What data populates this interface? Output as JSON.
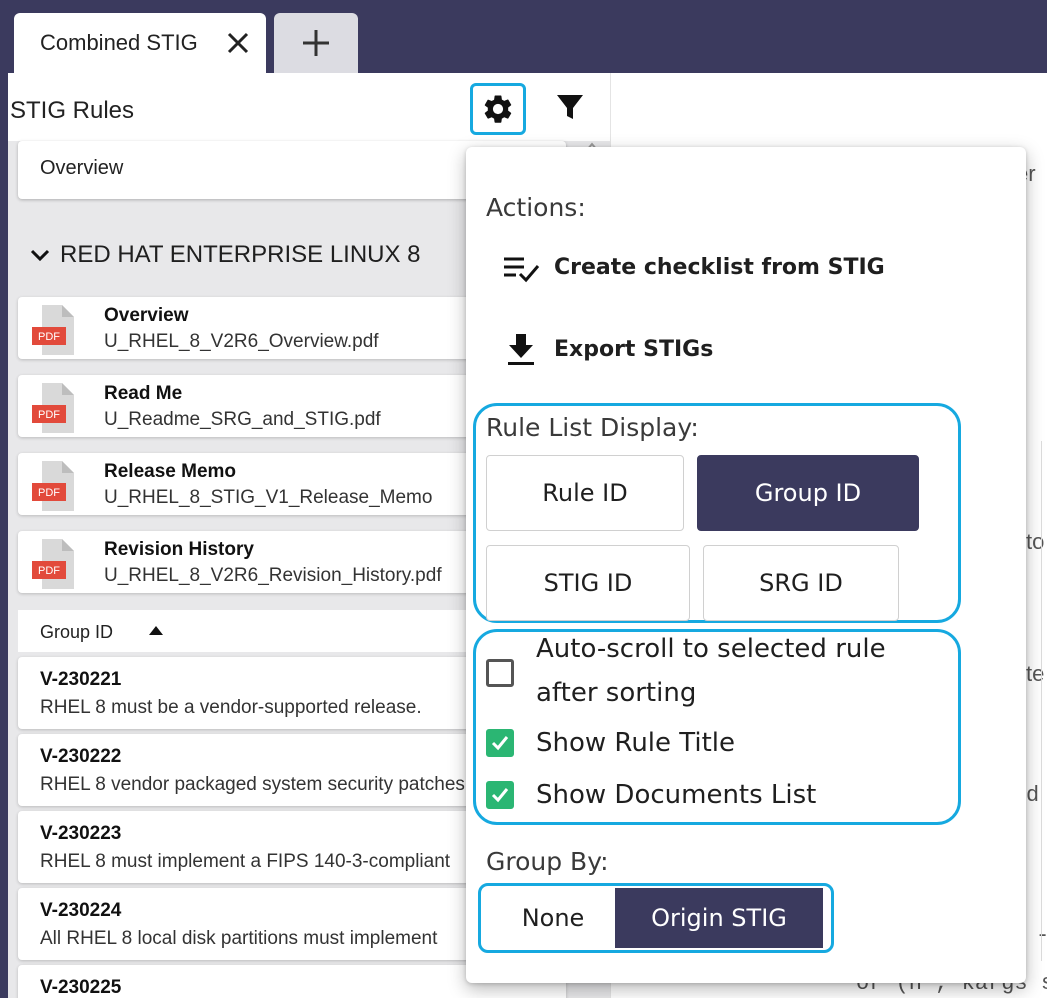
{
  "tabs": {
    "active_label": "Combined STIG",
    "close_icon": "close-icon",
    "new_icon": "plus-icon"
  },
  "sidebar": {
    "title": "STIG Rules",
    "settings_icon": "gear-icon",
    "filter_icon": "filter-icon",
    "overview_label": "Overview",
    "group_header": "RED HAT ENTERPRISE LINUX 8",
    "documents": [
      {
        "title": "Overview",
        "file": "U_RHEL_8_V2R6_Overview.pdf",
        "badge": "PDF"
      },
      {
        "title": "Read Me",
        "file": "U_Readme_SRG_and_STIG.pdf",
        "badge": "PDF"
      },
      {
        "title": "Release Memo",
        "file": "U_RHEL_8_STIG_V1_Release_Memo",
        "badge": "PDF"
      },
      {
        "title": "Revision History",
        "file": "U_RHEL_8_V2R6_Revision_History.pdf",
        "badge": "PDF"
      }
    ],
    "sort_label": "Group ID",
    "rules": [
      {
        "id": "V-230221",
        "title": "RHEL 8 must be a vendor-supported release."
      },
      {
        "id": "V-230222",
        "title": "RHEL 8 vendor packaged system security patches"
      },
      {
        "id": "V-230223",
        "title": "RHEL 8 must implement a FIPS 140-3-compliant"
      },
      {
        "id": "V-230224",
        "title": "All RHEL 8 local disk partitions must implement"
      },
      {
        "id": "V-230225",
        "title": ""
      }
    ]
  },
  "content_fragments": [
    "er",
    "to",
    "te",
    "d",
    "-",
    "or  (n     , kargs suc"
  ],
  "popup": {
    "actions_label": "Actions:",
    "create_checklist_label": "Create checklist from STIG",
    "export_label": "Export STIGs",
    "rule_list_display_label": "Rule List Display:",
    "display_options": [
      "Rule ID",
      "Group ID",
      "STIG ID",
      "SRG ID"
    ],
    "display_selected": "Group ID",
    "auto_scroll_label": "Auto-scroll to selected rule after sorting",
    "show_rule_title_label": "Show Rule Title",
    "show_documents_label": "Show Documents List",
    "auto_scroll_checked": false,
    "show_rule_title_checked": true,
    "show_documents_checked": true,
    "group_by_label": "Group By:",
    "group_by_options": [
      "None",
      "Origin STIG"
    ],
    "group_by_selected": "Origin STIG"
  },
  "colors": {
    "header_bg": "#3b3a5e",
    "highlight_outline": "#16a9e0",
    "checkbox_checked": "#2bb673",
    "pdf_red": "#e24a3b"
  }
}
